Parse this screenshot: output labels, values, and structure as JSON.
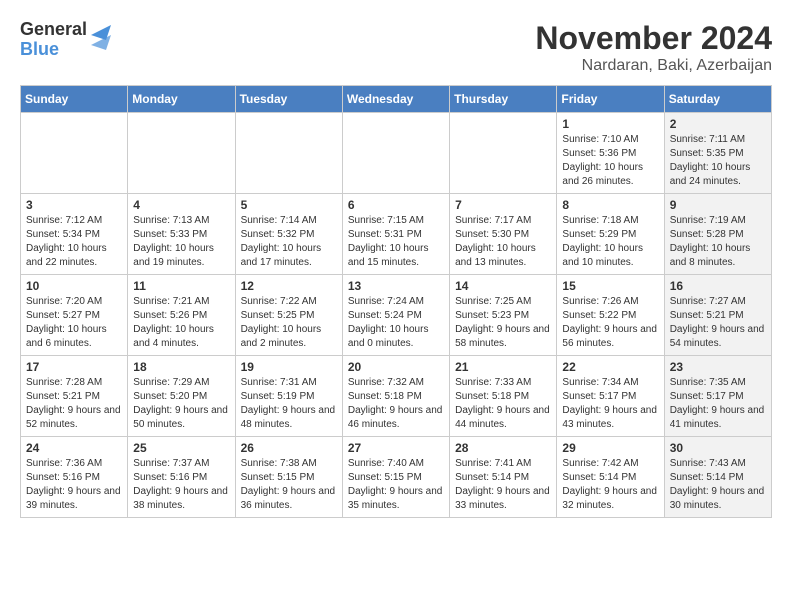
{
  "logo": {
    "general": "General",
    "blue": "Blue"
  },
  "title": {
    "month": "November 2024",
    "location": "Nardaran, Baki, Azerbaijan"
  },
  "weekdays": [
    "Sunday",
    "Monday",
    "Tuesday",
    "Wednesday",
    "Thursday",
    "Friday",
    "Saturday"
  ],
  "weeks": [
    [
      {
        "day": "",
        "sunrise": "",
        "sunset": "",
        "daylight": "",
        "shaded": false
      },
      {
        "day": "",
        "sunrise": "",
        "sunset": "",
        "daylight": "",
        "shaded": false
      },
      {
        "day": "",
        "sunrise": "",
        "sunset": "",
        "daylight": "",
        "shaded": false
      },
      {
        "day": "",
        "sunrise": "",
        "sunset": "",
        "daylight": "",
        "shaded": false
      },
      {
        "day": "",
        "sunrise": "",
        "sunset": "",
        "daylight": "",
        "shaded": false
      },
      {
        "day": "1",
        "sunrise": "Sunrise: 7:10 AM",
        "sunset": "Sunset: 5:36 PM",
        "daylight": "Daylight: 10 hours and 26 minutes.",
        "shaded": false
      },
      {
        "day": "2",
        "sunrise": "Sunrise: 7:11 AM",
        "sunset": "Sunset: 5:35 PM",
        "daylight": "Daylight: 10 hours and 24 minutes.",
        "shaded": true
      }
    ],
    [
      {
        "day": "3",
        "sunrise": "Sunrise: 7:12 AM",
        "sunset": "Sunset: 5:34 PM",
        "daylight": "Daylight: 10 hours and 22 minutes.",
        "shaded": false
      },
      {
        "day": "4",
        "sunrise": "Sunrise: 7:13 AM",
        "sunset": "Sunset: 5:33 PM",
        "daylight": "Daylight: 10 hours and 19 minutes.",
        "shaded": false
      },
      {
        "day": "5",
        "sunrise": "Sunrise: 7:14 AM",
        "sunset": "Sunset: 5:32 PM",
        "daylight": "Daylight: 10 hours and 17 minutes.",
        "shaded": false
      },
      {
        "day": "6",
        "sunrise": "Sunrise: 7:15 AM",
        "sunset": "Sunset: 5:31 PM",
        "daylight": "Daylight: 10 hours and 15 minutes.",
        "shaded": false
      },
      {
        "day": "7",
        "sunrise": "Sunrise: 7:17 AM",
        "sunset": "Sunset: 5:30 PM",
        "daylight": "Daylight: 10 hours and 13 minutes.",
        "shaded": false
      },
      {
        "day": "8",
        "sunrise": "Sunrise: 7:18 AM",
        "sunset": "Sunset: 5:29 PM",
        "daylight": "Daylight: 10 hours and 10 minutes.",
        "shaded": false
      },
      {
        "day": "9",
        "sunrise": "Sunrise: 7:19 AM",
        "sunset": "Sunset: 5:28 PM",
        "daylight": "Daylight: 10 hours and 8 minutes.",
        "shaded": true
      }
    ],
    [
      {
        "day": "10",
        "sunrise": "Sunrise: 7:20 AM",
        "sunset": "Sunset: 5:27 PM",
        "daylight": "Daylight: 10 hours and 6 minutes.",
        "shaded": false
      },
      {
        "day": "11",
        "sunrise": "Sunrise: 7:21 AM",
        "sunset": "Sunset: 5:26 PM",
        "daylight": "Daylight: 10 hours and 4 minutes.",
        "shaded": false
      },
      {
        "day": "12",
        "sunrise": "Sunrise: 7:22 AM",
        "sunset": "Sunset: 5:25 PM",
        "daylight": "Daylight: 10 hours and 2 minutes.",
        "shaded": false
      },
      {
        "day": "13",
        "sunrise": "Sunrise: 7:24 AM",
        "sunset": "Sunset: 5:24 PM",
        "daylight": "Daylight: 10 hours and 0 minutes.",
        "shaded": false
      },
      {
        "day": "14",
        "sunrise": "Sunrise: 7:25 AM",
        "sunset": "Sunset: 5:23 PM",
        "daylight": "Daylight: 9 hours and 58 minutes.",
        "shaded": false
      },
      {
        "day": "15",
        "sunrise": "Sunrise: 7:26 AM",
        "sunset": "Sunset: 5:22 PM",
        "daylight": "Daylight: 9 hours and 56 minutes.",
        "shaded": false
      },
      {
        "day": "16",
        "sunrise": "Sunrise: 7:27 AM",
        "sunset": "Sunset: 5:21 PM",
        "daylight": "Daylight: 9 hours and 54 minutes.",
        "shaded": true
      }
    ],
    [
      {
        "day": "17",
        "sunrise": "Sunrise: 7:28 AM",
        "sunset": "Sunset: 5:21 PM",
        "daylight": "Daylight: 9 hours and 52 minutes.",
        "shaded": false
      },
      {
        "day": "18",
        "sunrise": "Sunrise: 7:29 AM",
        "sunset": "Sunset: 5:20 PM",
        "daylight": "Daylight: 9 hours and 50 minutes.",
        "shaded": false
      },
      {
        "day": "19",
        "sunrise": "Sunrise: 7:31 AM",
        "sunset": "Sunset: 5:19 PM",
        "daylight": "Daylight: 9 hours and 48 minutes.",
        "shaded": false
      },
      {
        "day": "20",
        "sunrise": "Sunrise: 7:32 AM",
        "sunset": "Sunset: 5:18 PM",
        "daylight": "Daylight: 9 hours and 46 minutes.",
        "shaded": false
      },
      {
        "day": "21",
        "sunrise": "Sunrise: 7:33 AM",
        "sunset": "Sunset: 5:18 PM",
        "daylight": "Daylight: 9 hours and 44 minutes.",
        "shaded": false
      },
      {
        "day": "22",
        "sunrise": "Sunrise: 7:34 AM",
        "sunset": "Sunset: 5:17 PM",
        "daylight": "Daylight: 9 hours and 43 minutes.",
        "shaded": false
      },
      {
        "day": "23",
        "sunrise": "Sunrise: 7:35 AM",
        "sunset": "Sunset: 5:17 PM",
        "daylight": "Daylight: 9 hours and 41 minutes.",
        "shaded": true
      }
    ],
    [
      {
        "day": "24",
        "sunrise": "Sunrise: 7:36 AM",
        "sunset": "Sunset: 5:16 PM",
        "daylight": "Daylight: 9 hours and 39 minutes.",
        "shaded": false
      },
      {
        "day": "25",
        "sunrise": "Sunrise: 7:37 AM",
        "sunset": "Sunset: 5:16 PM",
        "daylight": "Daylight: 9 hours and 38 minutes.",
        "shaded": false
      },
      {
        "day": "26",
        "sunrise": "Sunrise: 7:38 AM",
        "sunset": "Sunset: 5:15 PM",
        "daylight": "Daylight: 9 hours and 36 minutes.",
        "shaded": false
      },
      {
        "day": "27",
        "sunrise": "Sunrise: 7:40 AM",
        "sunset": "Sunset: 5:15 PM",
        "daylight": "Daylight: 9 hours and 35 minutes.",
        "shaded": false
      },
      {
        "day": "28",
        "sunrise": "Sunrise: 7:41 AM",
        "sunset": "Sunset: 5:14 PM",
        "daylight": "Daylight: 9 hours and 33 minutes.",
        "shaded": false
      },
      {
        "day": "29",
        "sunrise": "Sunrise: 7:42 AM",
        "sunset": "Sunset: 5:14 PM",
        "daylight": "Daylight: 9 hours and 32 minutes.",
        "shaded": false
      },
      {
        "day": "30",
        "sunrise": "Sunrise: 7:43 AM",
        "sunset": "Sunset: 5:14 PM",
        "daylight": "Daylight: 9 hours and 30 minutes.",
        "shaded": true
      }
    ]
  ]
}
